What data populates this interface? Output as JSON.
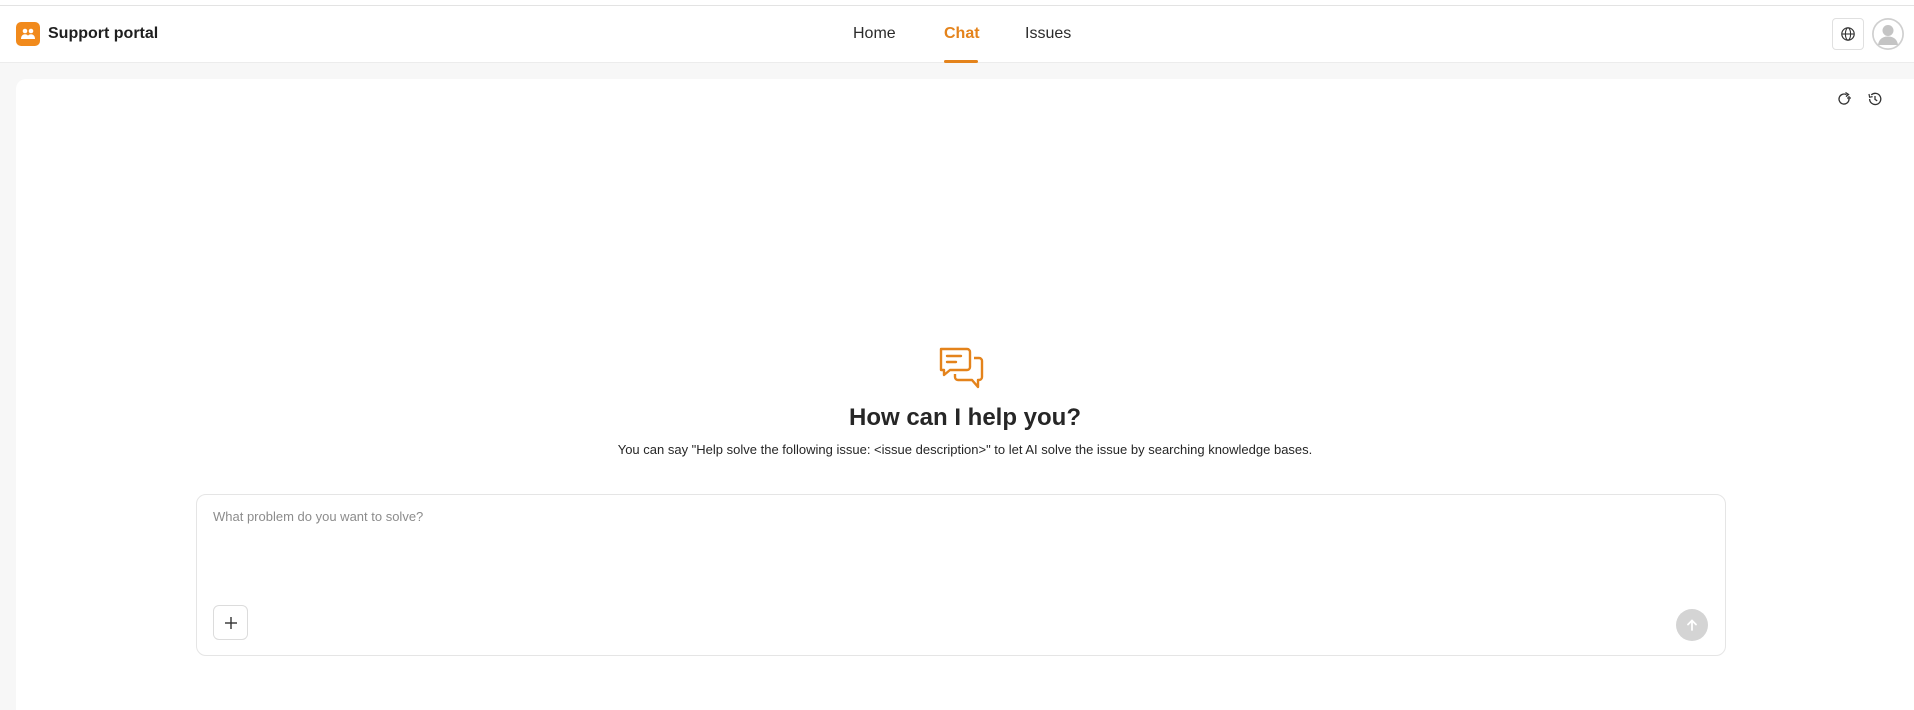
{
  "header": {
    "app_name": "Support portal",
    "nav": [
      {
        "label": "Home",
        "active": false
      },
      {
        "label": "Chat",
        "active": true
      },
      {
        "label": "Issues",
        "active": false
      }
    ],
    "icons": {
      "language": "globe-icon",
      "user": "avatar-icon",
      "logo": "people-icon"
    }
  },
  "main": {
    "toolbar_icons": [
      "refresh-chat-icon",
      "history-icon"
    ],
    "hero_icon": "chat-bubbles-icon",
    "headline": "How can I help you?",
    "subtext": "You can say \"Help solve the following issue: <issue description>\" to let AI solve the issue by searching knowledge bases.",
    "composer": {
      "placeholder": "What problem do you want to solve?",
      "value": ""
    }
  },
  "colors": {
    "accent": "#e4831b",
    "logo_bg": "#f18a1c",
    "send_disabled": "#d4d4d4"
  }
}
